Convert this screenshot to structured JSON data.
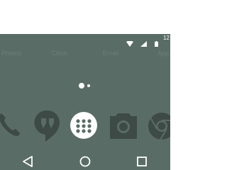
{
  "status_bar": {
    "time": "12",
    "icons": [
      "wifi-icon",
      "signal-icon",
      "battery-icon"
    ]
  },
  "home_row_labels": [
    "Photos",
    "Clock",
    "Email",
    "App"
  ],
  "page_indicator": {
    "pages": 2,
    "current_page": 1
  },
  "dock": {
    "apps": [
      "phone-icon",
      "hangouts-icon",
      "app-drawer-icon",
      "camera-icon",
      "chrome-icon"
    ]
  },
  "nav_bar": {
    "buttons": [
      "back",
      "home",
      "recents"
    ]
  },
  "colors": {
    "wallpaper": "#5a6c66",
    "dock_icon": "#3e4a45",
    "accent_white": "#ffffff"
  }
}
